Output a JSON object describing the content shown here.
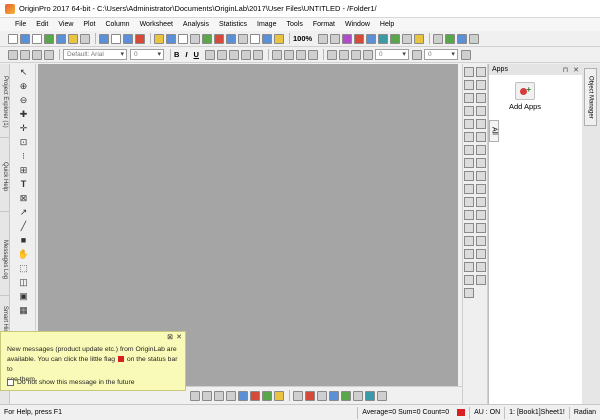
{
  "window": {
    "title": "OriginPro 2017 64-bit - C:\\Users\\Administrator\\Documents\\OriginLab\\2017\\User Files\\UNTITLED - /Folder1/"
  },
  "menu": [
    "File",
    "Edit",
    "View",
    "Plot",
    "Column",
    "Worksheet",
    "Analysis",
    "Statistics",
    "Image",
    "Tools",
    "Format",
    "Window",
    "Help"
  ],
  "toolbar": {
    "zoom": "100%",
    "font_name": "Default: Arial",
    "font_size": "0",
    "bold": "B",
    "italic": "I",
    "underline": "U",
    "size_box_1": "0",
    "size_box_2": "0"
  },
  "left_dock_tabs": [
    "Project Explorer (1)",
    "Quick Help",
    "Messages Log",
    "Smart Hint Log"
  ],
  "right_dock_tabs": [
    "Object Manager"
  ],
  "apps_panel": {
    "title": "Apps",
    "all_tab": "All",
    "add_apps_label": "Add Apps"
  },
  "notice": {
    "line1": "New messages (product update etc.) from OriginLab are",
    "line2": "available. You can click the little flag",
    "line3": "on the status bar to",
    "line4": "see them.",
    "checkbox_label": "Do not show this message in the future"
  },
  "status": {
    "help": "For Help, press F1",
    "stats": "Average=0 Sum=0 Count=0",
    "au": "AU : ON",
    "book": "1: [Book1]Sheet1!",
    "angle": "Radian"
  },
  "icons": {
    "left_tools": [
      "pointer-icon",
      "zoom-icon",
      "zoom-pan-icon",
      "screen-reader-icon",
      "data-reader-icon",
      "data-selector-icon",
      "draw-data-icon",
      "mask-icon",
      "text-tool-icon",
      "arrow-tool-icon",
      "line-tool-icon",
      "rectangle-tool-icon",
      "hand-icon",
      "region-icon",
      "polygon-icon"
    ]
  }
}
